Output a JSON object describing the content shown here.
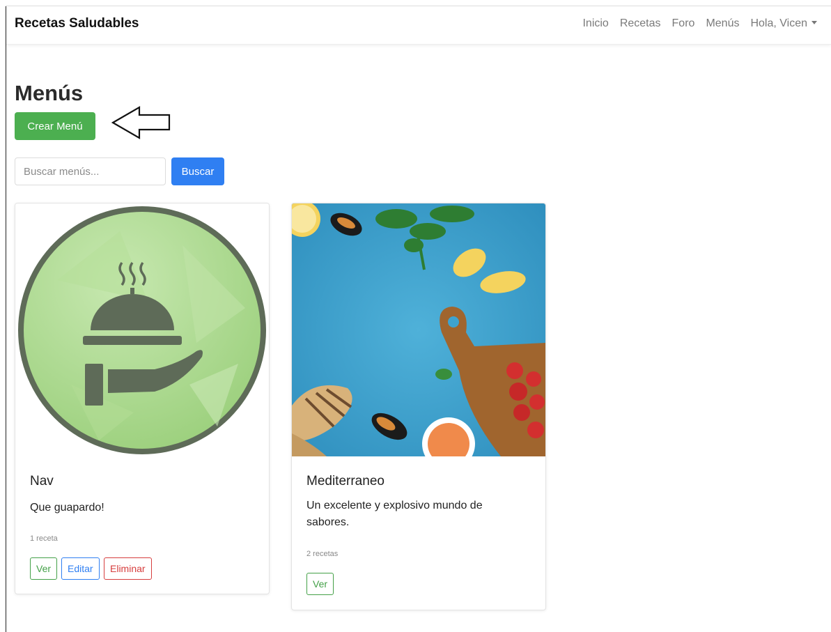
{
  "navbar": {
    "brand": "Recetas Saludables",
    "links": [
      "Inicio",
      "Recetas",
      "Foro",
      "Menús"
    ],
    "user_label": "Hola, Vicen"
  },
  "page": {
    "title": "Menús",
    "create_button": "Crear Menú"
  },
  "search": {
    "placeholder": "Buscar menús...",
    "button": "Buscar"
  },
  "menus": [
    {
      "title": "Nav",
      "description": "Que guapardo!",
      "count": "1 receta",
      "image": "serving-cloche-icon",
      "buttons": {
        "view": "Ver",
        "edit": "Editar",
        "delete": "Eliminar"
      }
    },
    {
      "title": "Mediterraneo",
      "description": "Un excelente y explosivo mundo de sabores.",
      "count": "2 recetas",
      "image": "mediterranean-food-photo",
      "buttons": {
        "view": "Ver"
      }
    }
  ],
  "colors": {
    "create": "#4caf50",
    "search": "#2f7ff2",
    "view": "#43a047",
    "edit": "#2f7ff2",
    "delete": "#d63d3d",
    "icon_bg": "#a8d88c",
    "icon_fg": "#5e6b58",
    "photo_bg": "#3ea3cf"
  }
}
